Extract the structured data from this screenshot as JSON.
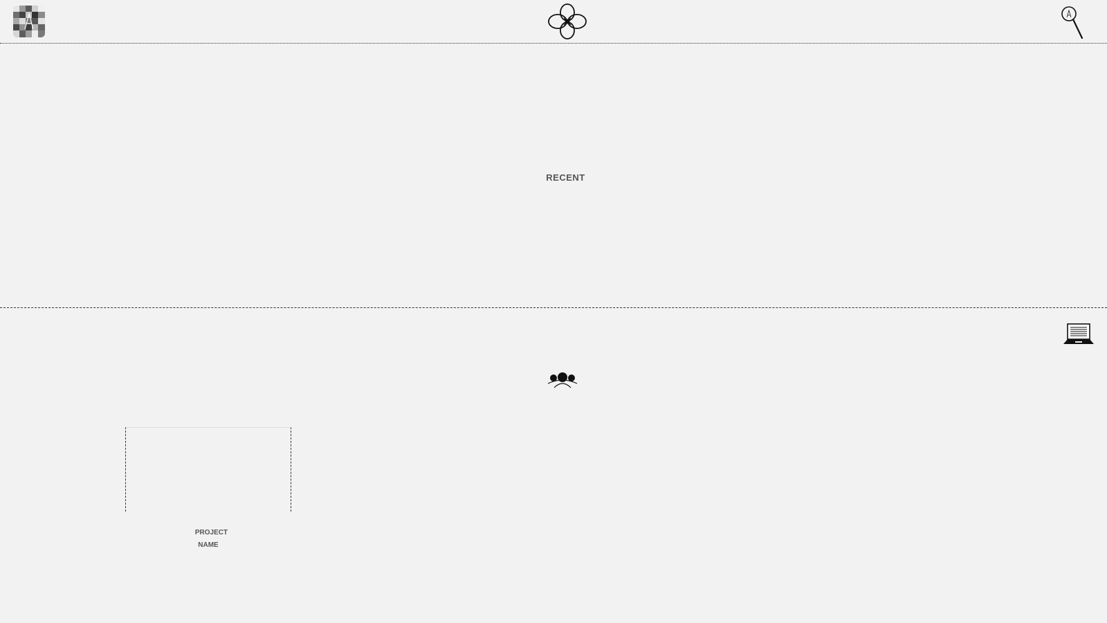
{
  "header": {
    "logo_icon": "app-logo-pixel-icon",
    "center_icon": "flower-icon",
    "search_icon": "search-icon"
  },
  "recent": {
    "label": "RECENT"
  },
  "devices": {
    "icon": "laptop-icon"
  },
  "team": {
    "icon": "group-icon"
  },
  "projects": [
    {
      "name_line1": "PROJECT",
      "name_line2": "NAME"
    }
  ],
  "colors": {
    "background": "#f2f2f2",
    "text": "#555555",
    "divider": "#333333"
  }
}
